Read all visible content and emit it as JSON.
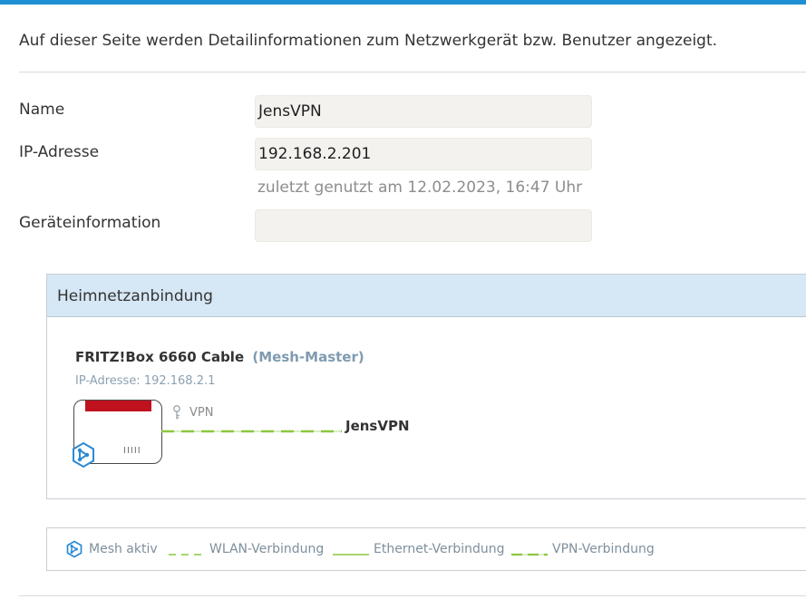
{
  "ui": {
    "accent_color": "#1f8fd3",
    "panel_header_color": "#d6e7f5",
    "router_top_color": "#c0111f",
    "vpn_line_color": "#8cc63f",
    "intro_text": "Auf dieser Seite werden Detailinformationen zum Netzwerkgerät bzw. Benutzer angezeigt."
  },
  "form": {
    "name_label": "Name",
    "name_value": "JensVPN",
    "ip_label": "IP-Adresse",
    "ip_value": "192.168.2.201",
    "last_used": "zuletzt genutzt am 12.02.2023, 16:47 Uhr",
    "device_info_label": "Geräteinformation",
    "device_info_value": ""
  },
  "home_network": {
    "title": "Heimnetzanbindung",
    "device_name": "FRITZ!Box 6660 Cable",
    "device_role": "(Mesh-Master)",
    "device_ip": "IP-Adresse: 192.168.2.1",
    "link_label": "VPN",
    "remote_name": "JensVPN",
    "icons": {
      "router": "router-icon",
      "mesh": "mesh-icon",
      "vpn": "key-icon"
    }
  },
  "legend": {
    "mesh_label": "Mesh aktiv",
    "wlan_label": "WLAN-Verbindung",
    "ethernet_label": "Ethernet-Verbindung",
    "vpn_label": "VPN-Verbindung"
  }
}
